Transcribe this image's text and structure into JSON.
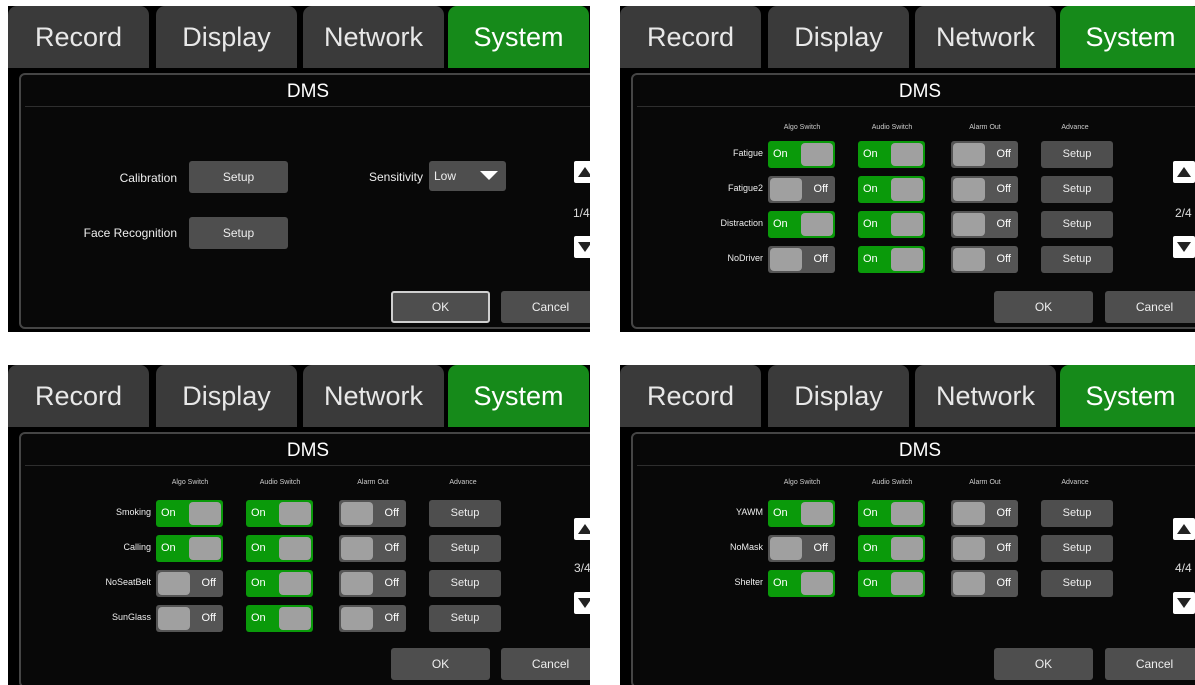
{
  "tabs": [
    "Record",
    "Display",
    "Network",
    "System"
  ],
  "active_tab": "System",
  "colors": {
    "active_tab": "#168a1a",
    "toggle_on": "#0a9a0a"
  },
  "screens": [
    {
      "title": "DMS",
      "calibration_label": "Calibration",
      "calibration_button": "Setup",
      "face_recognition_label": "Face Recognition",
      "face_recognition_button": "Setup",
      "sensitivity_label": "Sensitivity",
      "sensitivity_value": "Low",
      "page": "1/4",
      "ok": "OK",
      "cancel": "Cancel"
    },
    {
      "title": "DMS",
      "columns": [
        "Algo Switch",
        "Audio Switch",
        "Alarm Out",
        "Advance"
      ],
      "rows": [
        {
          "label": "Fatigue",
          "algo": "On",
          "audio": "On",
          "alarm": "Off",
          "advance": "Setup"
        },
        {
          "label": "Fatigue2",
          "algo": "Off",
          "audio": "On",
          "alarm": "Off",
          "advance": "Setup"
        },
        {
          "label": "Distraction",
          "algo": "On",
          "audio": "On",
          "alarm": "Off",
          "advance": "Setup"
        },
        {
          "label": "NoDriver",
          "algo": "Off",
          "audio": "On",
          "alarm": "Off",
          "advance": "Setup"
        }
      ],
      "page": "2/4",
      "ok": "OK",
      "cancel": "Cancel"
    },
    {
      "title": "DMS",
      "columns": [
        "Algo Switch",
        "Audio Switch",
        "Alarm Out",
        "Advance"
      ],
      "rows": [
        {
          "label": "Smoking",
          "algo": "On",
          "audio": "On",
          "alarm": "Off",
          "advance": "Setup"
        },
        {
          "label": "Calling",
          "algo": "On",
          "audio": "On",
          "alarm": "Off",
          "advance": "Setup"
        },
        {
          "label": "NoSeatBelt",
          "algo": "Off",
          "audio": "On",
          "alarm": "Off",
          "advance": "Setup"
        },
        {
          "label": "SunGlass",
          "algo": "Off",
          "audio": "On",
          "alarm": "Off",
          "advance": "Setup"
        }
      ],
      "page": "3/4",
      "ok": "OK",
      "cancel": "Cancel"
    },
    {
      "title": "DMS",
      "columns": [
        "Algo Switch",
        "Audio Switch",
        "Alarm Out",
        "Advance"
      ],
      "rows": [
        {
          "label": "YAWM",
          "algo": "On",
          "audio": "On",
          "alarm": "Off",
          "advance": "Setup"
        },
        {
          "label": "NoMask",
          "algo": "Off",
          "audio": "On",
          "alarm": "Off",
          "advance": "Setup"
        },
        {
          "label": "Shelter",
          "algo": "On",
          "audio": "On",
          "alarm": "Off",
          "advance": "Setup"
        }
      ],
      "page": "4/4",
      "ok": "OK",
      "cancel": "Cancel"
    }
  ]
}
